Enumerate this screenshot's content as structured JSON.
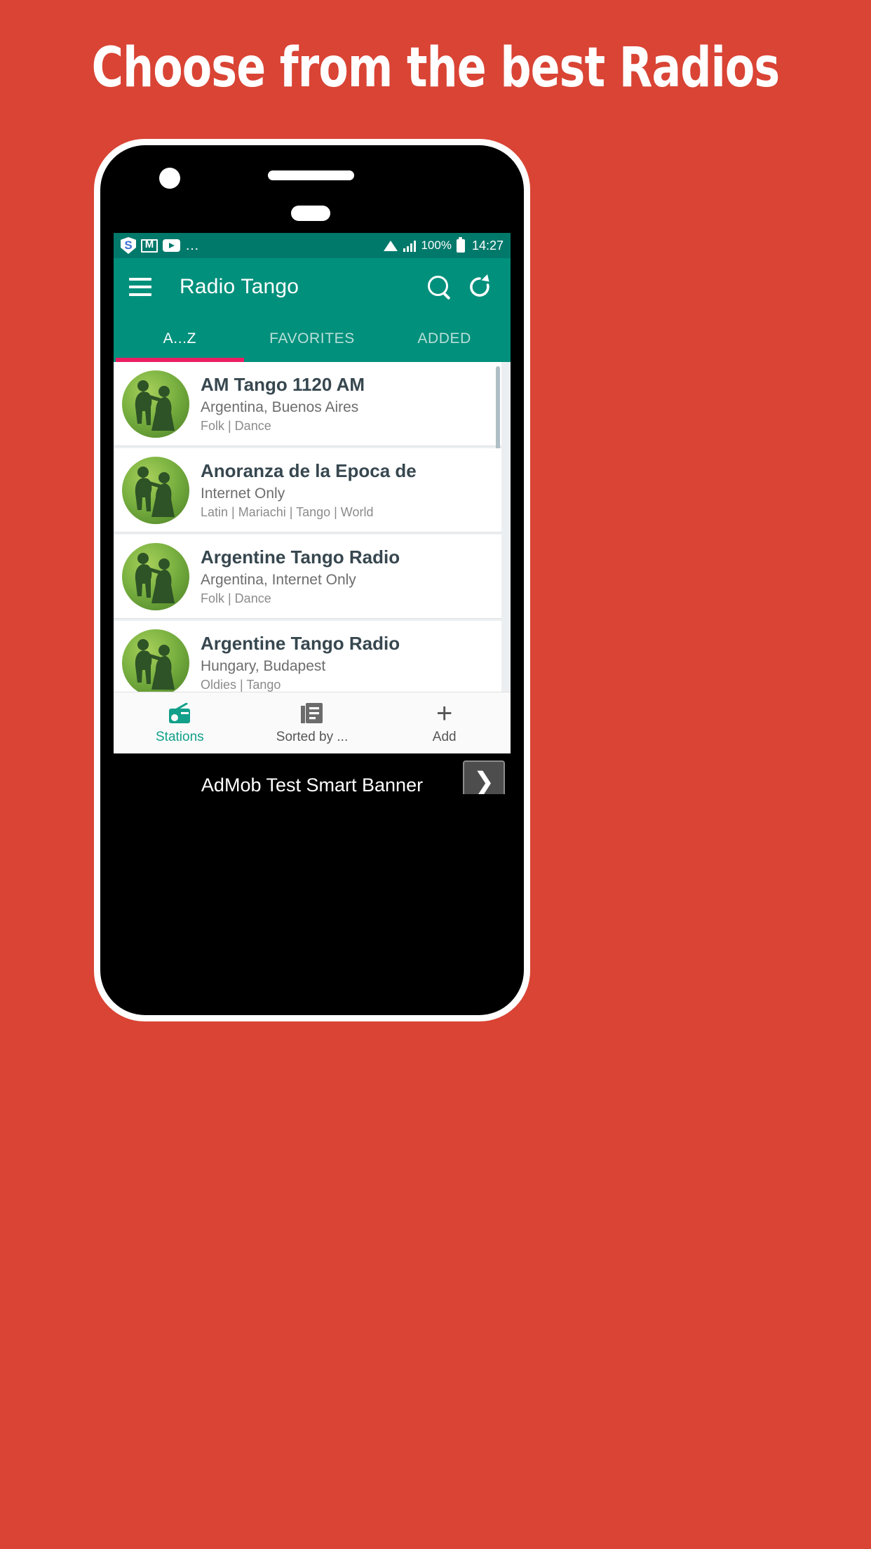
{
  "promo": {
    "headline": "Choose from the best Radios",
    "background_color": "#d94435"
  },
  "statusbar": {
    "time": "14:27",
    "battery_text": "100%",
    "overflow": "…",
    "icons": [
      "shield-s-icon",
      "gmail-icon",
      "youtube-icon",
      "overflow-dots-icon",
      "wifi-icon",
      "cellular-signal-icon",
      "battery-icon"
    ],
    "shield_letter": "S",
    "bg_color": "#00796b"
  },
  "toolbar": {
    "title": "Radio Tango",
    "menu_icon": "hamburger-menu-icon",
    "search_icon": "search-icon",
    "refresh_icon": "refresh-icon",
    "bg_color": "#00907c"
  },
  "tabs": {
    "items": [
      {
        "label": "A...Z",
        "active": true
      },
      {
        "label": "FAVORITES",
        "active": false
      },
      {
        "label": "ADDED",
        "active": false
      }
    ],
    "indicator_color": "#ec1e63"
  },
  "stations": [
    {
      "name": "AM Tango 1120 AM",
      "location": "Argentina, Buenos Aires",
      "tags": "Folk | Dance"
    },
    {
      "name": "Anoranza de la Epoca de",
      "location": "Internet Only",
      "tags": "Latin | Mariachi | Tango | World"
    },
    {
      "name": "Argentine Tango Radio",
      "location": "Argentina, Internet Only",
      "tags": "Folk | Dance"
    },
    {
      "name": "Argentine Tango Radio",
      "location": "Hungary, Budapest",
      "tags": "Oldies | Tango"
    }
  ],
  "bottom_nav": [
    {
      "label": "Stations",
      "icon": "radio-icon",
      "active": true
    },
    {
      "label": "Sorted by ...",
      "icon": "list-sort-icon",
      "active": false
    },
    {
      "label": "Add",
      "icon": "plus-icon",
      "active": false
    }
  ],
  "admob": {
    "text": "AdMob Test Smart Banner",
    "arrow": "❯",
    "dots": 3,
    "active_dot": 0
  }
}
